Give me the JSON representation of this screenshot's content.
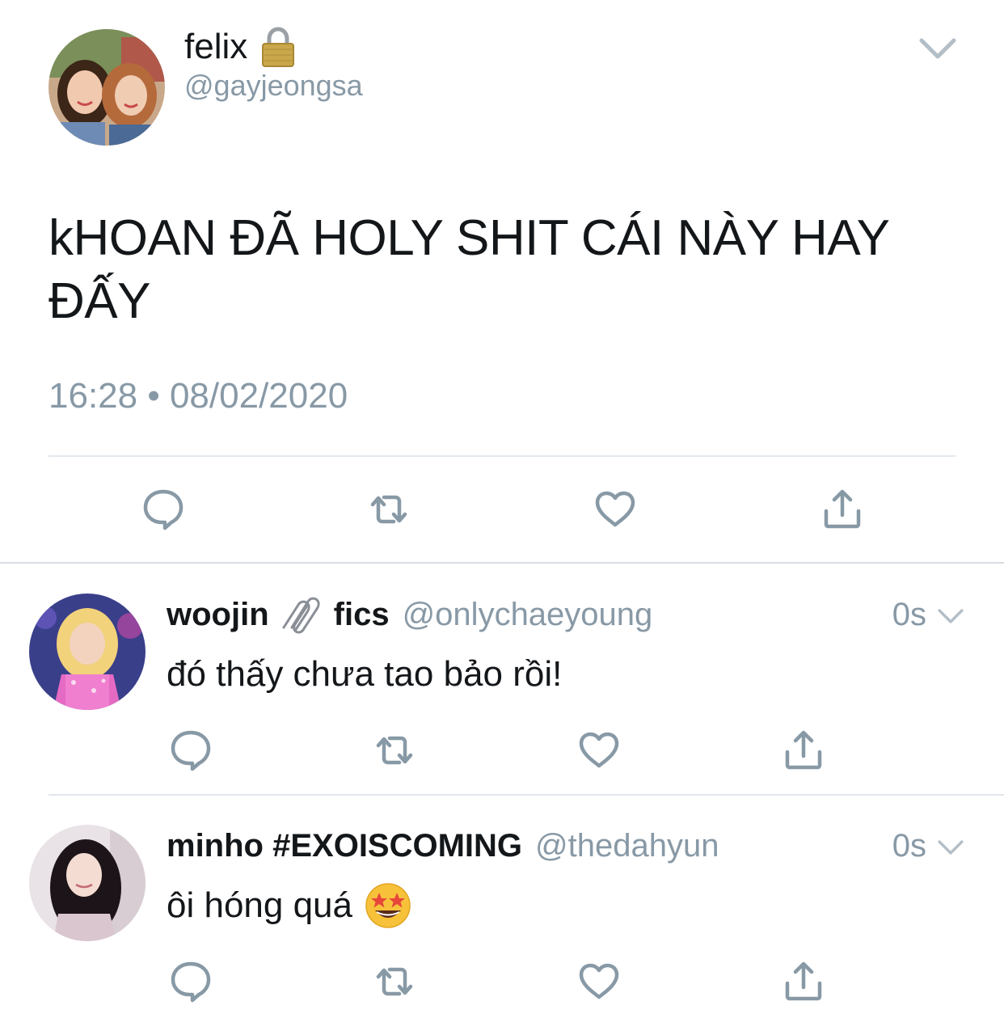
{
  "main_tweet": {
    "author_name": "felix",
    "author_handle": "@gayjeongsa",
    "name_icon": "lock-icon",
    "text": "kHOAN ĐÃ HOLY SHIT CÁI NÀY HAY ĐẤY",
    "timestamp": "16:28 • 08/02/2020",
    "actions": [
      "reply-icon",
      "retweet-icon",
      "like-icon",
      "share-icon"
    ]
  },
  "replies": [
    {
      "author_name": "woojin",
      "name_icon": "paperclip-icon",
      "author_name_suffix": "fics",
      "author_handle": "@onlychaeyoung",
      "time": "0s",
      "text": "đó thấy chưa tao bảo rồi!",
      "actions": [
        "reply-icon",
        "retweet-icon",
        "like-icon",
        "share-icon"
      ]
    },
    {
      "author_name": "minho #EXOISCOMING",
      "author_handle": "@thedahyun",
      "time": "0s",
      "text": "ôi hóng quá",
      "text_emoji": "star-struck-emoji-icon",
      "actions": [
        "reply-icon",
        "retweet-icon",
        "like-icon",
        "share-icon"
      ]
    }
  ],
  "colors": {
    "text_primary": "#14171a",
    "text_secondary": "#8899a6",
    "icon_gray": "#8899a6",
    "divider": "#e1e8ed",
    "background": "#ffffff"
  }
}
